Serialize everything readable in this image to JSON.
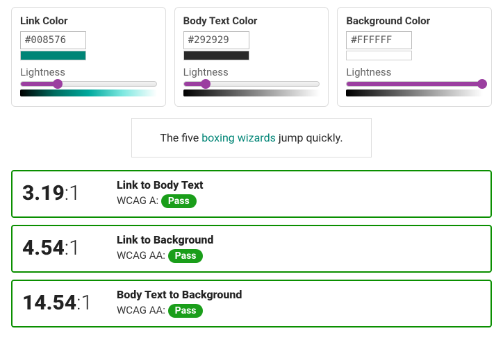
{
  "pickers": [
    {
      "title": "Link Color",
      "hex": "#008576",
      "lightness_label": "Lightness",
      "slider_pct": 27,
      "swatch": "#008576",
      "grad_class": "grad-link"
    },
    {
      "title": "Body Text Color",
      "hex": "#292929",
      "lightness_label": "Lightness",
      "slider_pct": 16,
      "swatch": "#292929",
      "grad_class": "grad-body"
    },
    {
      "title": "Background Color",
      "hex": "#FFFFFF",
      "lightness_label": "Lightness",
      "slider_pct": 100,
      "swatch": "#FFFFFF",
      "grad_class": "grad-bg"
    }
  ],
  "sample": {
    "before": "The five ",
    "link": "boxing wizards",
    "after": " jump quickly."
  },
  "results": [
    {
      "ratio_num": "3.19",
      "ratio_suffix": ":1",
      "title": "Link to Body Text",
      "level_prefix": "WCAG A: ",
      "badge": "Pass"
    },
    {
      "ratio_num": "4.54",
      "ratio_suffix": ":1",
      "title": "Link to Background",
      "level_prefix": "WCAG AA: ",
      "badge": "Pass"
    },
    {
      "ratio_num": "14.54",
      "ratio_suffix": ":1",
      "title": "Body Text to Background",
      "level_prefix": "WCAG AA: ",
      "badge": "Pass"
    }
  ],
  "colors": {
    "accent": "#9b3fa0",
    "pass_badge": "#1a9e1a",
    "result_border": "#0a8f00",
    "link_hex": "#008576",
    "body_hex": "#292929",
    "bg_hex": "#FFFFFF"
  }
}
